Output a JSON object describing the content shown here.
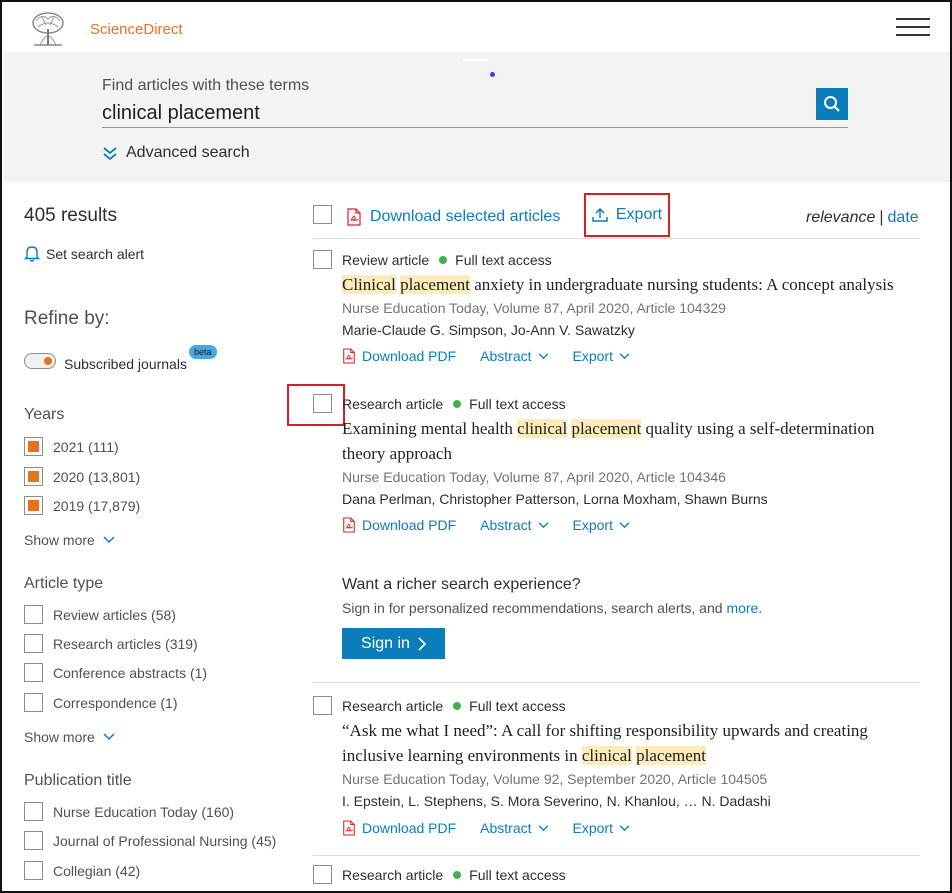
{
  "header": {
    "brand": "ScienceDirect"
  },
  "search": {
    "label": "Find articles with these terms",
    "query": "clinical placement",
    "advanced_label": "Advanced search"
  },
  "sidebar": {
    "results_count": "405 results",
    "search_alert": "Set search alert",
    "refine_title": "Refine by:",
    "subscribed_label": "Subscribed journals",
    "beta_badge": "beta",
    "years": {
      "title": "Years",
      "items": [
        {
          "label": "2021 (111)",
          "checked": true
        },
        {
          "label": "2020 (13,801)",
          "checked": true
        },
        {
          "label": "2019 (17,879)",
          "checked": true
        }
      ],
      "show_more": "Show more"
    },
    "article_type": {
      "title": "Article type",
      "items": [
        {
          "label": "Review articles (58)"
        },
        {
          "label": "Research articles (319)"
        },
        {
          "label": "Conference abstracts (1)"
        },
        {
          "label": "Correspondence (1)"
        }
      ],
      "show_more": "Show more"
    },
    "publication": {
      "title": "Publication title",
      "items": [
        {
          "label": "Nurse Education Today (160)"
        },
        {
          "label": "Journal of Professional Nursing (45)"
        },
        {
          "label": "Collegian (42)"
        }
      ]
    }
  },
  "toolbar": {
    "download_selected": "Download selected articles",
    "export": "Export",
    "sort_relevance": "relevance",
    "sort_sep": "|",
    "sort_date": "date"
  },
  "articles": [
    {
      "type": "Review article",
      "access": "Full text access",
      "title_parts": [
        "Clinical",
        " ",
        "placement",
        " anxiety in undergraduate nursing students: A concept analysis"
      ],
      "source": "Nurse Education Today, Volume 87, April 2020, Article 104329",
      "authors": "Marie-Claude G. Simpson, Jo-Ann V. Sawatzky"
    },
    {
      "type": "Research article",
      "access": "Full text access",
      "title_parts": [
        "Examining mental health ",
        "clinical",
        " ",
        "placement",
        " quality using a self-determination theory approach"
      ],
      "source": "Nurse Education Today, Volume 87, April 2020, Article 104346",
      "authors": "Dana Perlman, Christopher Patterson, Lorna Moxham, Shawn Burns"
    },
    {
      "type": "Research article",
      "access": "Full text access",
      "title_parts": [
        "“Ask me what I need”: A call for shifting responsibility upwards and creating inclusive learning environments in ",
        "clinical",
        " ",
        "placement"
      ],
      "source": "Nurse Education Today, Volume 92, September 2020, Article 104505",
      "authors": "I. Epstein, L. Stephens, S. Mora Severino, N. Khanlou, … N. Dadashi"
    },
    {
      "type": "Research article",
      "access": "Full text access"
    }
  ],
  "article_actions": {
    "download_pdf": "Download PDF",
    "abstract": "Abstract",
    "export": "Export"
  },
  "promo": {
    "title": "Want a richer search experience?",
    "subtitle": "Sign in for personalized recommendations, search alerts, and ",
    "more": "more.",
    "signin": "Sign in"
  },
  "colors": {
    "brand_orange": "#e9711c",
    "link_blue": "#0c7dbb",
    "highlight": "#fcecba",
    "access_green": "#3bb54a",
    "annotation_red": "#d81f26"
  }
}
